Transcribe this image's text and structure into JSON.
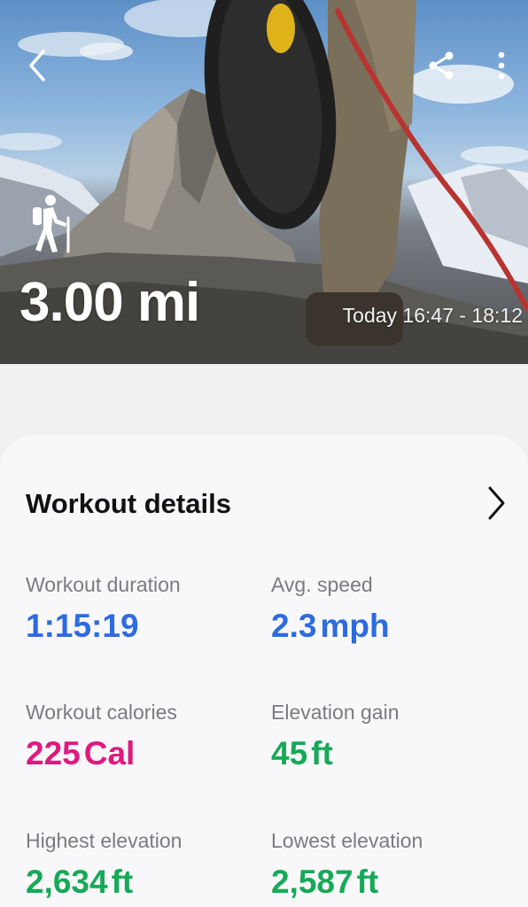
{
  "header": {
    "activity_icon": "hiking-icon",
    "distance": "3.00 mi",
    "time_range": "Today 16:47 - 18:12",
    "icons": {
      "back": "back-arrow-icon",
      "share": "share-icon",
      "more": "more-vertical-icon"
    }
  },
  "details": {
    "title": "Workout details",
    "chevron_icon": "chevron-right-icon",
    "metrics": [
      {
        "label": "Workout duration",
        "value": "1:15:19",
        "unit": "",
        "color": "#2d6be0"
      },
      {
        "label": "Avg. speed",
        "value": "2.3",
        "unit": "mph",
        "color": "#2d6be0"
      },
      {
        "label": "Workout calories",
        "value": "225",
        "unit": "Cal",
        "color": "#e0197f"
      },
      {
        "label": "Elevation gain",
        "value": "45",
        "unit": "ft",
        "color": "#17a957"
      },
      {
        "label": "Highest elevation",
        "value": "2,634",
        "unit": "ft",
        "color": "#17a957"
      },
      {
        "label": "Lowest elevation",
        "value": "2,587",
        "unit": "ft",
        "color": "#17a957"
      }
    ]
  }
}
